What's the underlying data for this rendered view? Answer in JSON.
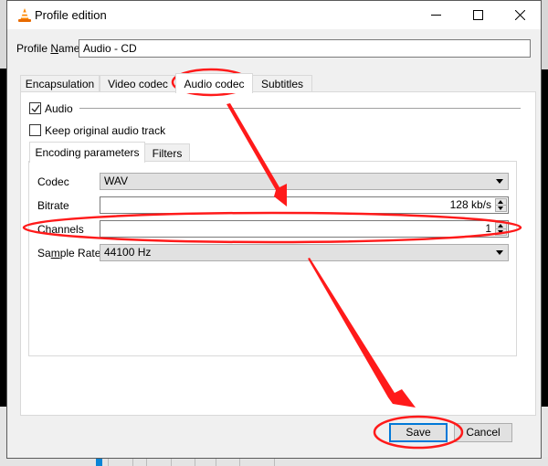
{
  "window": {
    "title": "Profile edition",
    "controls": {
      "minimize": "minimize",
      "maximize": "maximize",
      "close": "close"
    }
  },
  "profile": {
    "label_pre": "Profile ",
    "label_mnemonic": "N",
    "label_post": "ame",
    "value": "Audio - CD"
  },
  "tabs": [
    {
      "label": "Encapsulation",
      "active": false
    },
    {
      "label": "Video codec",
      "active": false
    },
    {
      "label": "Audio codec",
      "active": true
    },
    {
      "label": "Subtitles",
      "active": false
    }
  ],
  "audio": {
    "enabled_label": "Audio",
    "enabled_checked": true,
    "keep_original_label": "Keep original audio track",
    "keep_original_checked": false
  },
  "subtabs": [
    {
      "label": "Encoding parameters",
      "active": true
    },
    {
      "label": "Filters",
      "active": false
    }
  ],
  "encoding": {
    "codec": {
      "label": "Codec",
      "value": "WAV"
    },
    "bitrate": {
      "label": "Bitrate",
      "value": "128 kb/s"
    },
    "channels": {
      "label": "Channels",
      "value": "1"
    },
    "sample_rate": {
      "label_pre": "Sa",
      "label_mnemonic": "m",
      "label_post": "ple Rate",
      "value": "44100 Hz"
    }
  },
  "buttons": {
    "save": "Save",
    "cancel": "Cancel"
  },
  "annotations": {
    "color": "#ff1a1a"
  }
}
